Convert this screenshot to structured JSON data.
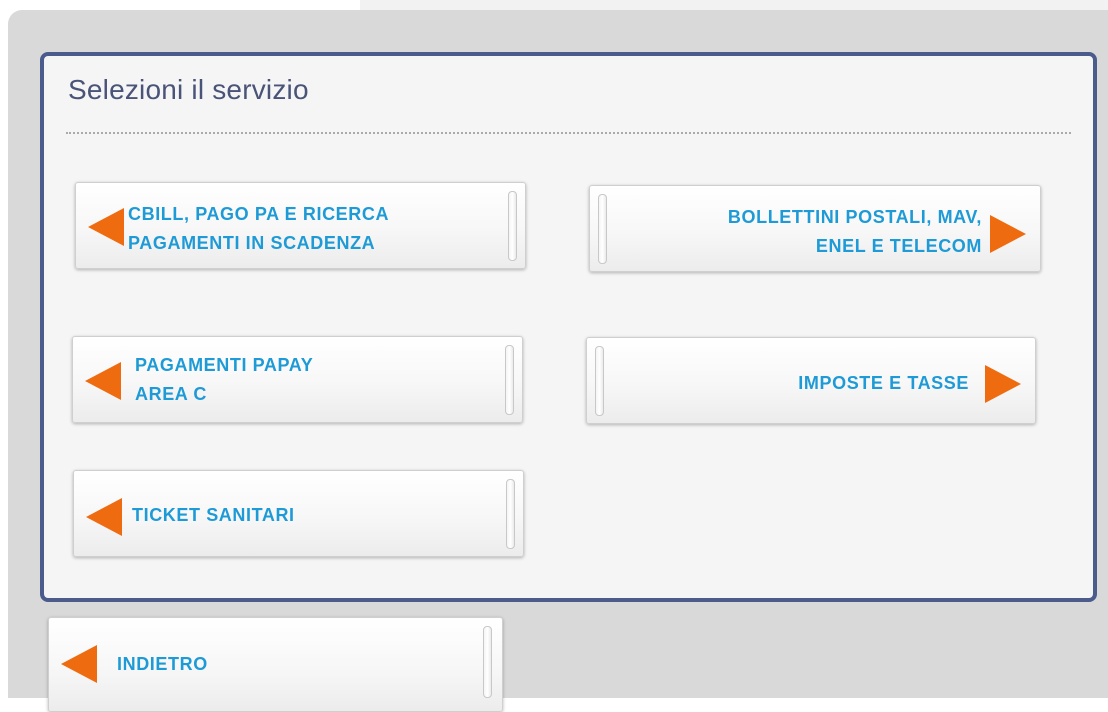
{
  "panel": {
    "title": "Selezioni il servizio"
  },
  "services": {
    "cbill": {
      "line1": "CBILL, PAGO PA E RICERCA",
      "line2": "PAGAMENTI IN SCADENZA",
      "icon": "arrow-left-icon"
    },
    "bollettini": {
      "line1": "BOLLETTINI POSTALI, MAV,",
      "line2": "ENEL E TELECOM",
      "icon": "arrow-right-icon"
    },
    "papay": {
      "line1": "PAGAMENTI PAPAY",
      "line2": "AREA C",
      "icon": "arrow-left-icon"
    },
    "imposte": {
      "line1": "IMPOSTE E TASSE",
      "icon": "arrow-right-icon"
    },
    "ticket": {
      "line1": "TICKET SANITARI",
      "icon": "arrow-left-icon"
    }
  },
  "nav": {
    "back": {
      "label": "INDIETRO",
      "icon": "arrow-left-icon"
    }
  },
  "colors": {
    "accent_arrow": "#ef6b10",
    "label_text": "#1e9ad6",
    "panel_border": "#4a5b8c",
    "title_text": "#4a5378"
  }
}
